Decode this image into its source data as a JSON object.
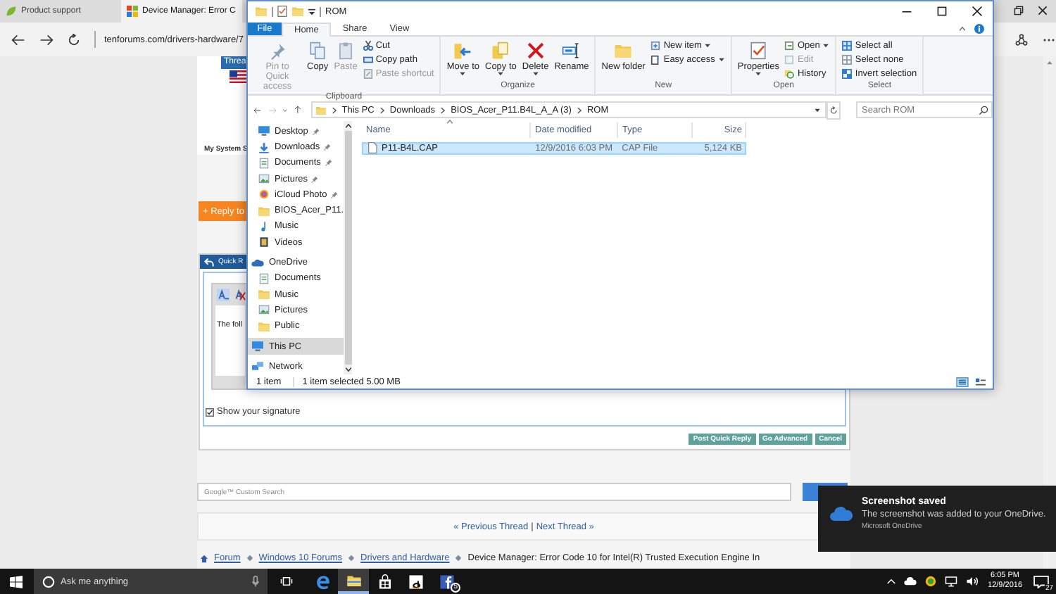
{
  "browser": {
    "tabs": [
      {
        "label": "Product support",
        "selected": false
      },
      {
        "label": "Device Manager: Error C",
        "selected": true
      }
    ],
    "address": "tenforums.com/drivers-hardware/7"
  },
  "forum": {
    "thread_tab": "Threa",
    "system_link": "My System S",
    "reply_button": "+ Reply to",
    "quick_reply": {
      "title": "Quick R",
      "editor_text": "The foll",
      "signature": {
        "label": "Show your signature",
        "checked": true
      },
      "buttons": [
        "Post Quick Reply",
        "Go Advanced",
        "Cancel"
      ]
    },
    "search": {
      "placeholder": "Google™ Custom Search"
    },
    "thread_nav": {
      "previous": "« Previous Thread",
      "separator": "|",
      "next": "Next Thread »"
    },
    "breadcrumb": [
      "Forum",
      "Windows 10 Forums",
      "Drivers and Hardware",
      "Device Manager: Error Code 10 for Intel(R) Trusted Execution Engine In"
    ]
  },
  "explorer": {
    "title": "ROM",
    "file_tab": "File",
    "ribbon_tabs": [
      {
        "label": "Home",
        "selected": true
      },
      {
        "label": "Share",
        "selected": false
      },
      {
        "label": "View",
        "selected": false
      }
    ],
    "groups": [
      {
        "label": "Clipboard",
        "commands": [
          {
            "label": "Pin to Quick access",
            "kind": "large",
            "disabled": true,
            "dropdown": false
          },
          {
            "label": "Copy",
            "kind": "large",
            "disabled": false,
            "dropdown": false
          },
          {
            "label": "Paste",
            "kind": "large",
            "disabled": true,
            "dropdown": false
          },
          {
            "label": "Cut",
            "kind": "small",
            "disabled": false,
            "dropdown": false
          },
          {
            "label": "Copy path",
            "kind": "small",
            "disabled": false,
            "dropdown": false
          },
          {
            "label": "Paste shortcut",
            "kind": "small",
            "disabled": true,
            "dropdown": false
          }
        ]
      },
      {
        "label": "Organize",
        "commands": [
          {
            "label": "Move to",
            "kind": "large",
            "disabled": false,
            "dropdown": true
          },
          {
            "label": "Copy to",
            "kind": "large",
            "disabled": false,
            "dropdown": true
          },
          {
            "label": "Delete",
            "kind": "large",
            "disabled": false,
            "dropdown": true
          },
          {
            "label": "Rename",
            "kind": "large",
            "disabled": false,
            "dropdown": false
          }
        ]
      },
      {
        "label": "New",
        "commands": [
          {
            "label": "New folder",
            "kind": "large",
            "disabled": false,
            "dropdown": false
          },
          {
            "label": "New item",
            "kind": "small",
            "disabled": false,
            "dropdown": true
          },
          {
            "label": "Easy access",
            "kind": "small",
            "disabled": false,
            "dropdown": true
          }
        ]
      },
      {
        "label": "Open",
        "commands": [
          {
            "label": "Properties",
            "kind": "large",
            "disabled": false,
            "dropdown": true
          },
          {
            "label": "Open",
            "kind": "small",
            "disabled": false,
            "dropdown": true
          },
          {
            "label": "Edit",
            "kind": "small",
            "disabled": true,
            "dropdown": false
          },
          {
            "label": "History",
            "kind": "small",
            "disabled": false,
            "dropdown": false
          }
        ]
      },
      {
        "label": "Select",
        "commands": [
          {
            "label": "Select all",
            "kind": "small",
            "disabled": false,
            "dropdown": false
          },
          {
            "label": "Select none",
            "kind": "small",
            "disabled": false,
            "dropdown": false
          },
          {
            "label": "Invert selection",
            "kind": "small",
            "disabled": false,
            "dropdown": false
          }
        ]
      }
    ],
    "path": [
      "This PC",
      "Downloads",
      "BIOS_Acer_P11.B4L_A_A (3)",
      "ROM"
    ],
    "search": {
      "placeholder": "Search ROM"
    },
    "quick_access": [
      {
        "label": "Desktop",
        "pinned": true
      },
      {
        "label": "Downloads",
        "pinned": true
      },
      {
        "label": "Documents",
        "pinned": true
      },
      {
        "label": "Pictures",
        "pinned": true
      },
      {
        "label": "iCloud Photo",
        "pinned": true
      },
      {
        "label": "BIOS_Acer_P11.",
        "pinned": false
      },
      {
        "label": "Music",
        "pinned": false
      },
      {
        "label": "Videos",
        "pinned": false
      }
    ],
    "roots": [
      {
        "label": "OneDrive",
        "selected": false,
        "children": [
          {
            "label": "Documents",
            "selected": false
          },
          {
            "label": "Music",
            "selected": false
          },
          {
            "label": "Pictures",
            "selected": false
          },
          {
            "label": "Public",
            "selected": false
          }
        ]
      },
      {
        "label": "This PC",
        "selected": true
      },
      {
        "label": "Network",
        "selected": false
      }
    ],
    "columns": [
      "Name",
      "Date modified",
      "Type",
      "Size"
    ],
    "files": [
      {
        "name": "P11-B4L.CAP",
        "date": "12/9/2016 6:03 PM",
        "type": "CAP File",
        "size": "5,124 KB",
        "selected": true
      }
    ],
    "status": {
      "count": "1 item",
      "selection": "1 item selected  5.00 MB"
    }
  },
  "notification": {
    "title": "Screenshot saved",
    "body": "The screenshot was added to your OneDrive.",
    "source": "Microsoft OneDrive"
  },
  "taskbar": {
    "search_placeholder": "Ask me anything",
    "apps": [
      {
        "kind": "edge",
        "active": false
      },
      {
        "kind": "explorer",
        "active": true
      },
      {
        "kind": "store",
        "active": false
      },
      {
        "kind": "amazon",
        "active": false
      },
      {
        "kind": "facebook",
        "active": false,
        "badge": "5"
      }
    ],
    "time": "6:05 PM",
    "date": "12/9/2016",
    "notification_count": "27"
  }
}
